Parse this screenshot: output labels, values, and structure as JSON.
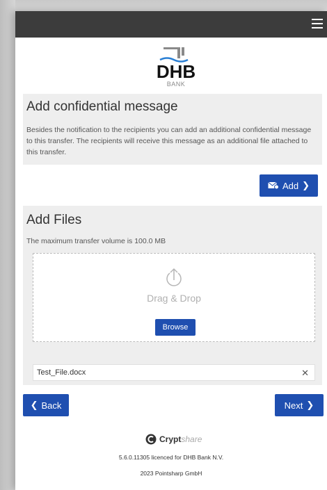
{
  "bank": {
    "name": "DHB",
    "sub": "BANK"
  },
  "message_section": {
    "title": "Add confidential message",
    "description": "Besides the notification to the recipients you can add an additional confidential message to this transfer. The recipients will receive this message as an additional file attached to this transfer.",
    "add_label": "Add"
  },
  "files_section": {
    "title": "Add Files",
    "limit": "The maximum transfer volume is 100.0 MB",
    "drop_label": "Drag & Drop",
    "browse_label": "Browse",
    "files": [
      {
        "name": "Test_File.docx"
      }
    ]
  },
  "nav": {
    "back_label": "Back",
    "next_label": "Next"
  },
  "footer": {
    "brand": "Crypt",
    "brand_suffix": "share",
    "version": "5.6.0.11305 licenced for DHB Bank N.V.",
    "copyright": "2023 Pointsharp GmbH"
  },
  "colors": {
    "primary": "#1f4fb0",
    "topbar": "#3c3c3c",
    "panel": "#eeeeee"
  }
}
